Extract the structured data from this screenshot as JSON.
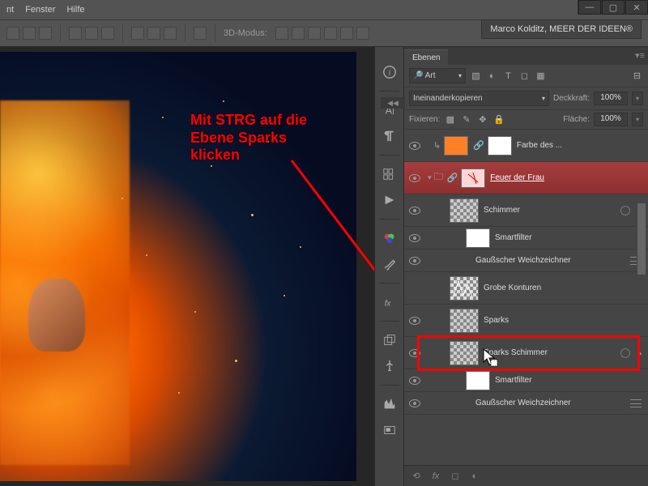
{
  "menu": {
    "item1": "nt",
    "item2": "Fenster",
    "item3": "Hilfe"
  },
  "user_badge": "Marco Kolditz, MEER DER IDEEN®",
  "mode3d": "3D-Modus:",
  "annotation": {
    "line1": "Mit STRG auf die",
    "line2": "Ebene Sparks",
    "line3": "klicken"
  },
  "panel": {
    "tab": "Ebenen"
  },
  "filter": {
    "label": "Art"
  },
  "blend": {
    "mode": "Ineinanderkopieren",
    "opacity_label": "Deckkraft:",
    "opacity": "100%"
  },
  "fill": {
    "lock_label": "Fixieren:",
    "fill_label": "Fläche:",
    "fill": "100%"
  },
  "layers": {
    "l1": "Farbe des ...",
    "l2": "Feuer der Frau",
    "l3": "Schimmer",
    "l4": "Smartfilter",
    "l5": "Gaußscher Weichzeichner",
    "l6": "Grobe Konturen",
    "l7": "Sparks",
    "l8": "Sparks Schimmer",
    "l9": "Smartfilter",
    "l10": "Gaußscher Weichzeichner"
  }
}
